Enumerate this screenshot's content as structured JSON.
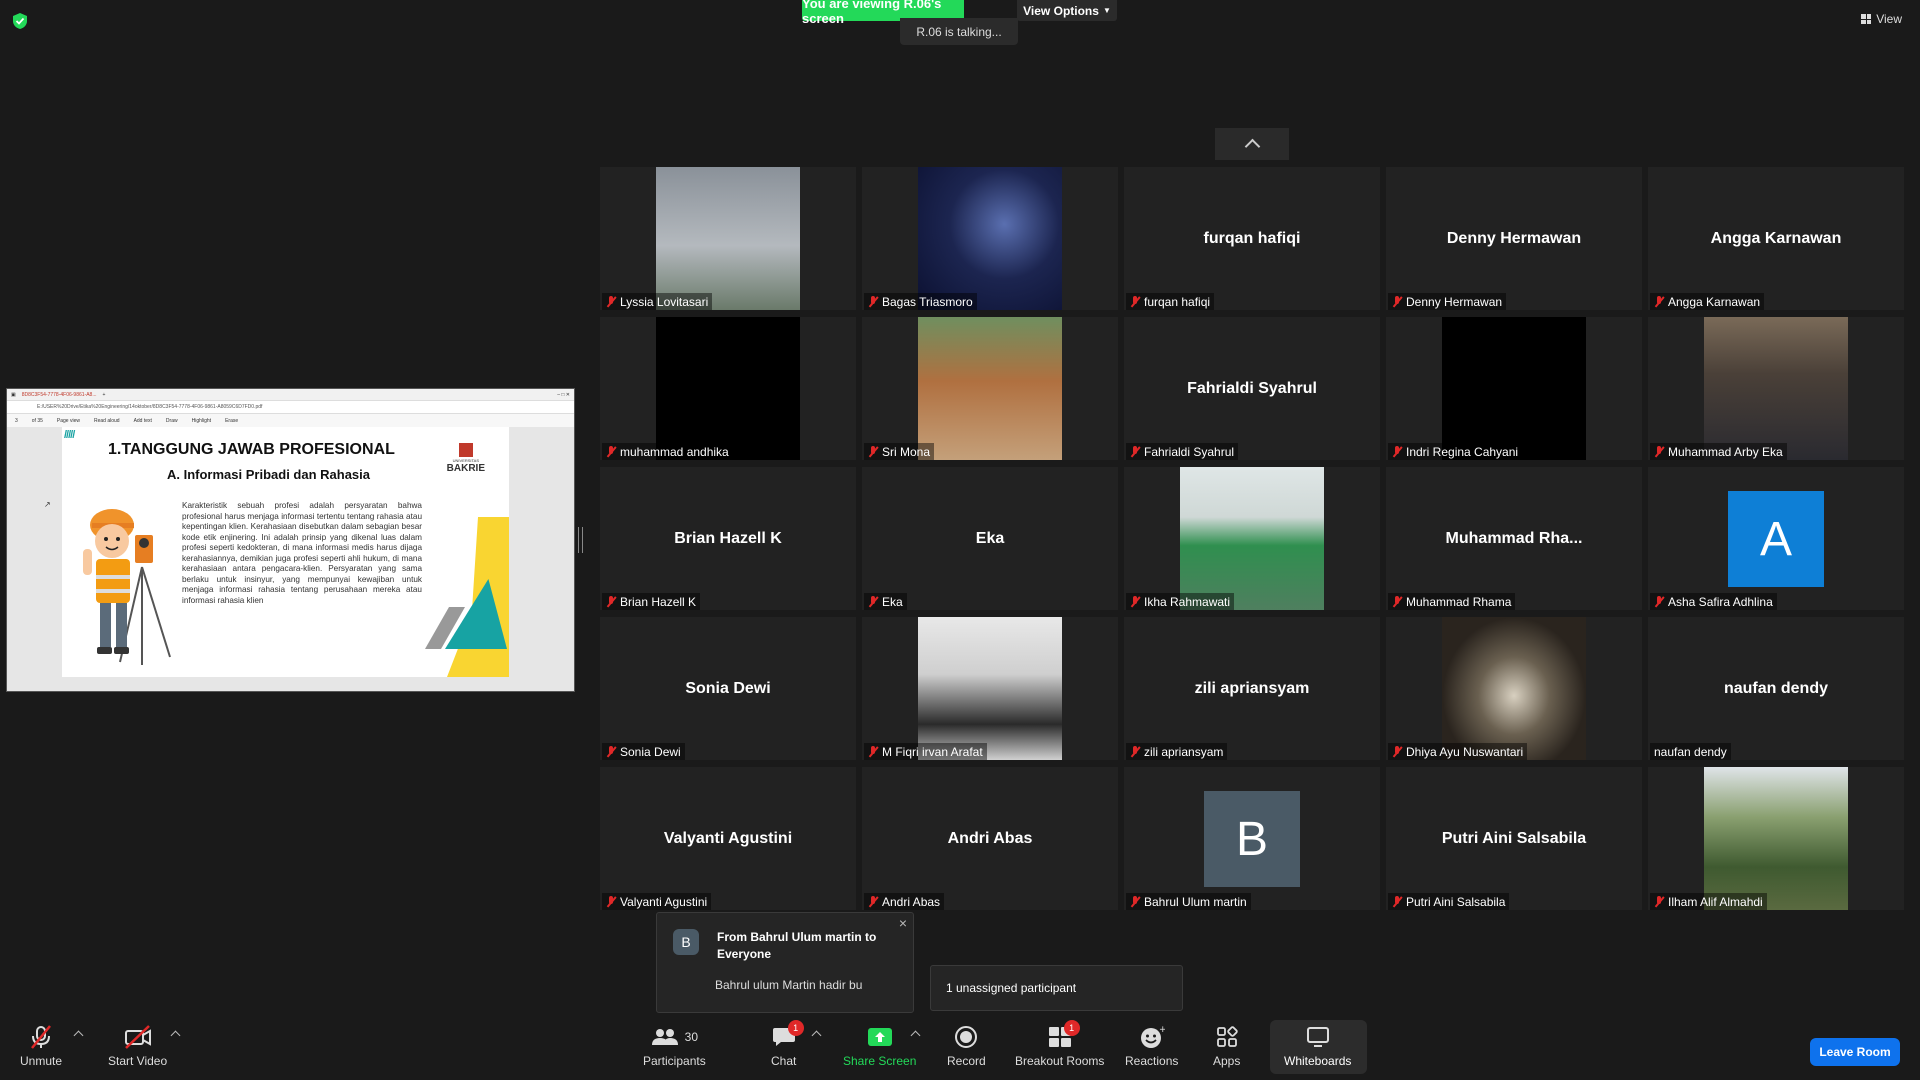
{
  "banner": {
    "viewing": "You are viewing R.06's screen",
    "view_options": "View Options",
    "talking": "R.06 is talking..."
  },
  "top_right": {
    "view": "View"
  },
  "shared_screen": {
    "tab_title": "8D8C3F54-7778-4F06-9861-A8...",
    "address": "E:/USER%20Drive/Etika%20Engineering/14oktober/8D8C3F54-7778-4F06-9861-A8059C6D7FD0.pdf",
    "page_num": "3",
    "page_total": "of 35",
    "tools": [
      "Page view",
      "Read aloud",
      "Add text",
      "Draw",
      "Highlight",
      "Erase"
    ],
    "slide": {
      "title": "1.TANGGUNG JAWAB PROFESIONAL",
      "subtitle": "A. Informasi Pribadi dan Rahasia",
      "logo_small": "UNIVERSITAS",
      "logo_main": "BAKRIE",
      "body": "Karakteristik sebuah profesi adalah persyaratan bahwa profesional harus menjaga informasi tertentu tentang rahasia atau kepentingan klien. Kerahasiaan disebutkan dalam sebagian besar kode etik enjinering. Ini adalah prinsip yang dikenal luas dalam profesi seperti kedokteran, di mana informasi medis harus dijaga kerahasiannya, demikian juga profesi seperti ahli hukum, di mana kerahasiaan antara pengacara-klien. Persyaratan yang sama berlaku untuk insinyur, yang mempunyai kewajiban untuk menjaga informasi rahasia tentang perusahaan mereka atau informasi rahasia klien"
    }
  },
  "participants_grid": [
    {
      "name": "Lyssia Lovitasari",
      "big": "",
      "muted": true,
      "video": "tower"
    },
    {
      "name": "Bagas Triasmoro",
      "big": "",
      "muted": true,
      "video": "stars"
    },
    {
      "name": "furqan hafiqi",
      "big": "furqan hafiqi",
      "muted": true,
      "video": ""
    },
    {
      "name": "Denny Hermawan",
      "big": "Denny Hermawan",
      "muted": true,
      "video": ""
    },
    {
      "name": "Angga Karnawan",
      "big": "Angga Karnawan",
      "muted": true,
      "video": ""
    },
    {
      "name": "muhammad andhika",
      "big": "",
      "muted": true,
      "video": "black"
    },
    {
      "name": "Sri Mona",
      "big": "",
      "muted": true,
      "video": "couple"
    },
    {
      "name": "Fahrialdi Syahrul",
      "big": "Fahrialdi Syahrul",
      "muted": true,
      "video": ""
    },
    {
      "name": "Indri Regina Cahyani",
      "big": "",
      "muted": true,
      "video": "black"
    },
    {
      "name": "Muhammad Arby Eka",
      "big": "",
      "muted": true,
      "video": "suit"
    },
    {
      "name": "Brian Hazell K",
      "big": "Brian Hazell K",
      "muted": true,
      "video": ""
    },
    {
      "name": "Eka",
      "big": "Eka",
      "muted": true,
      "video": ""
    },
    {
      "name": "Ikha Rahmawati",
      "big": "",
      "muted": true,
      "video": "building"
    },
    {
      "name": "Muhammad Rhama",
      "big": "Muhammad  Rha...",
      "muted": true,
      "video": ""
    },
    {
      "name": "Asha Safira Adhlina",
      "big": "",
      "muted": true,
      "video": "",
      "avatar": "A",
      "avatar_color": "#0e7fd6"
    },
    {
      "name": "Sonia Dewi",
      "big": "Sonia Dewi",
      "muted": true,
      "video": ""
    },
    {
      "name": "M Fiqri irvan Arafat",
      "big": "",
      "muted": true,
      "video": "desk"
    },
    {
      "name": "zili apriansyam",
      "big": "zili apriansyam",
      "muted": true,
      "video": ""
    },
    {
      "name": "Dhiya Ayu Nuswantari",
      "big": "",
      "muted": true,
      "video": "tunnel"
    },
    {
      "name": "naufan dendy",
      "big": "naufan dendy",
      "muted": false,
      "video": ""
    },
    {
      "name": "Valyanti Agustini",
      "big": "Valyanti Agustini",
      "muted": true,
      "video": ""
    },
    {
      "name": "Andri Abas",
      "big": "Andri Abas",
      "muted": true,
      "video": ""
    },
    {
      "name": "Bahrul Ulum martin",
      "big": "",
      "muted": true,
      "video": "",
      "avatar": "B",
      "avatar_color": "#4a5a66"
    },
    {
      "name": "Putri Aini Salsabila",
      "big": "Putri Aini Salsabila",
      "muted": true,
      "video": ""
    },
    {
      "name": "Ilham Alif Almahdi",
      "big": "",
      "muted": true,
      "video": "hill"
    }
  ],
  "chat_popup": {
    "avatar": "B",
    "from": "From Bahrul Ulum martin to Everyone",
    "message": "Bahrul ulum Martin hadir bu",
    "close": "×"
  },
  "unassigned": "1 unassigned participant",
  "toolbar": {
    "unmute": "Unmute",
    "start_video": "Start Video",
    "participants": "Participants",
    "participants_count": "30",
    "chat": "Chat",
    "chat_badge": "1",
    "share_screen": "Share Screen",
    "record": "Record",
    "breakout": "Breakout Rooms",
    "breakout_badge": "1",
    "reactions": "Reactions",
    "apps": "Apps",
    "whiteboards": "Whiteboards",
    "leave": "Leave Room"
  },
  "colors": {
    "accent_green": "#23d959",
    "leave_blue": "#0e72ed",
    "muted_red": "#e02828"
  }
}
